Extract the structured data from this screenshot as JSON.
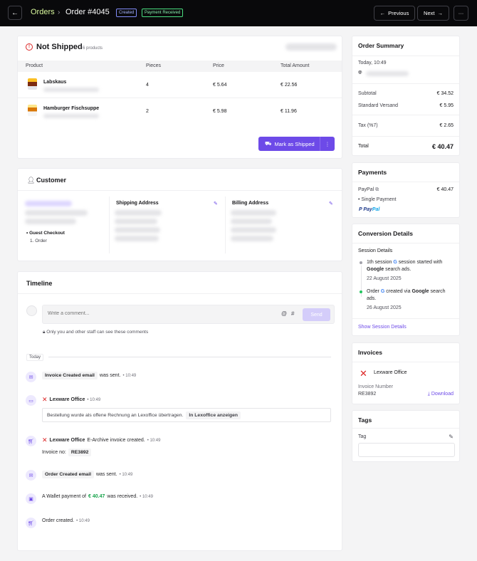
{
  "header": {
    "breadcrumb_root": "Orders",
    "order_title": "Order #4045",
    "badge_created": "Created",
    "badge_payment": "Payment Received",
    "prev_label": "Previous",
    "next_label": "Next"
  },
  "not_shipped": {
    "title": "Not Shipped",
    "count": "6 products",
    "columns": [
      "Product",
      "Pieces",
      "Price",
      "Total Amount"
    ],
    "rows": [
      {
        "product": "Labskaus",
        "pieces": "4",
        "price": "€ 5.64",
        "total": "€ 22.56"
      },
      {
        "product": "Hamburger Fischsuppe",
        "pieces": "2",
        "price": "€ 5.98",
        "total": "€ 11.96"
      }
    ],
    "ship_button": "Mark as Shipped"
  },
  "customer": {
    "title": "Customer",
    "guest": "Guest Checkout",
    "orders": "1. Order",
    "shipping_title": "Shipping Address",
    "billing_title": "Billing Address"
  },
  "timeline": {
    "title": "Timeline",
    "comment_placeholder": "Write a comment...",
    "send": "Send",
    "staff_note": "Only you and other staff can see these comments",
    "today": "Today",
    "events": {
      "e1_chip": "Invoice Created email",
      "e1_text": "was sent.",
      "e1_time": "10:49",
      "e2_source": "Lexware Office",
      "e2_time": "10:49",
      "e2_quote": "Bestellung wurde als offene Rechnung an Lexoffice übertragen.",
      "e2_link": "In Lexoffice anzeigen",
      "e3_source": "Lexware Office",
      "e3_text": "E-Archive invoice created.",
      "e3_time": "10:49",
      "e3_invoice_label": "Invoice no:",
      "e3_invoice_no": "RE3892",
      "e4_chip": "Order Created email",
      "e4_text": "was sent.",
      "e4_time": "10:49",
      "e5_pre": "A Wallet payment of",
      "e5_amount": "€ 40.47",
      "e5_post": "was received.",
      "e5_time": "10:49",
      "e6_text": "Order created.",
      "e6_time": "10:49"
    }
  },
  "summary": {
    "title": "Order Summary",
    "date": "Today, 10:49",
    "subtotal_label": "Subtotal",
    "subtotal": "€ 34.52",
    "shipping_label": "Standard Versand",
    "shipping": "€ 5.95",
    "tax_label": "Tax (%7)",
    "tax": "€ 2.65",
    "total_label": "Total",
    "total": "€ 40.47"
  },
  "payments": {
    "title": "Payments",
    "method": "PayPal",
    "amount": "€ 40.47",
    "type": "• Single Payment",
    "logo_a": "Pay",
    "logo_b": "Pal"
  },
  "conversion": {
    "title": "Conversion Details",
    "subtitle": "Session Details",
    "s1_pre": "1th session",
    "s1_post": "session started with",
    "s1_bold": "Google",
    "s1_end": "search ads.",
    "s1_date": "22 August 2025",
    "s2_pre": "Order",
    "s2_mid": "created via",
    "s2_bold": "Google",
    "s2_end": "search ads.",
    "s2_date": "26 August 2025",
    "link": "Show Session Details"
  },
  "invoices": {
    "title": "Invoices",
    "provider": "Lexware Office",
    "number_label": "Invoice Number",
    "number": "RE3892",
    "download": "Download"
  },
  "tags": {
    "title": "Tags",
    "label": "Tag"
  },
  "colors": {
    "accent": "#6d4ae8",
    "topbar": "#09090b",
    "danger": "#dc2626",
    "success": "#16a34a"
  }
}
